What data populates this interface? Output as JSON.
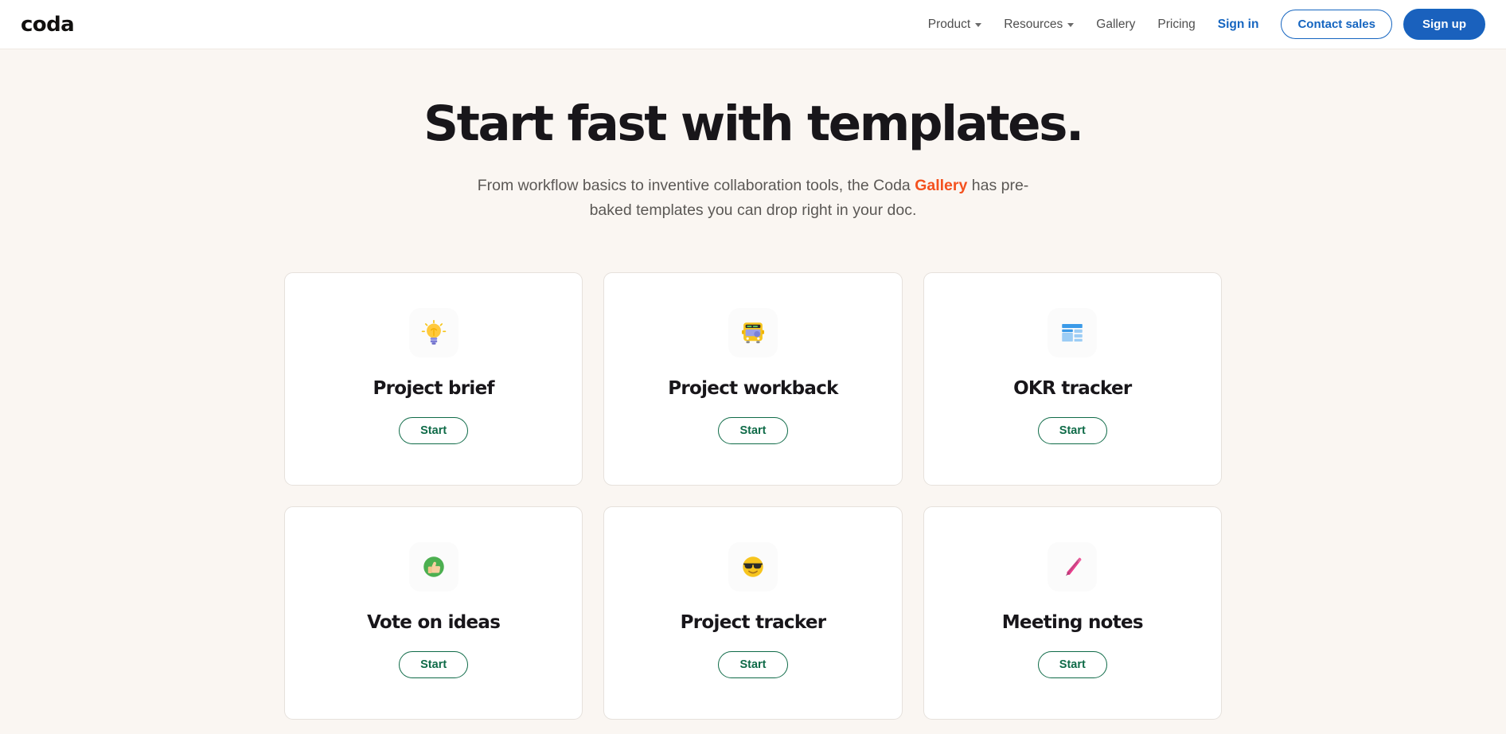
{
  "header": {
    "brand": "coda",
    "nav": [
      {
        "label": "Product",
        "icon": "chevron-down-icon",
        "has_caret": true,
        "style": "plain"
      },
      {
        "label": "Resources",
        "icon": "chevron-down-icon",
        "has_caret": true,
        "style": "plain"
      },
      {
        "label": "Gallery",
        "icon": "",
        "has_caret": false,
        "style": "plain"
      },
      {
        "label": "Pricing",
        "icon": "",
        "has_caret": false,
        "style": "plain"
      },
      {
        "label": "Sign in",
        "icon": "",
        "has_caret": false,
        "style": "accent"
      }
    ],
    "contact_sales_label": "Contact sales",
    "sign_up_label": "Sign up"
  },
  "hero": {
    "title": "Start fast with templates.",
    "subtitle_before": "From workflow basics to inventive collaboration tools, the Coda ",
    "subtitle_link": "Gallery",
    "subtitle_after": " has pre-baked templates you can drop right in your doc."
  },
  "cards": [
    {
      "title": "Project brief",
      "icon": "lightbulb-icon",
      "button_label": "Start"
    },
    {
      "title": "Project workback",
      "icon": "bus-icon",
      "button_label": "Start"
    },
    {
      "title": "OKR tracker",
      "icon": "dashboard-icon",
      "button_label": "Start"
    },
    {
      "title": "Vote on ideas",
      "icon": "thumbs-up-icon",
      "button_label": "Start"
    },
    {
      "title": "Project tracker",
      "icon": "sunglasses-face-icon",
      "button_label": "Start"
    },
    {
      "title": "Meeting notes",
      "icon": "pen-icon",
      "button_label": "Start"
    }
  ],
  "colors": {
    "page_background": "#faf6f2",
    "card_background": "#ffffff",
    "brand_blue": "#1565c0",
    "accent_orange": "#f4511e",
    "start_green": "#0f6b48",
    "text_dark": "#18161a",
    "text_muted": "#5b5855"
  }
}
